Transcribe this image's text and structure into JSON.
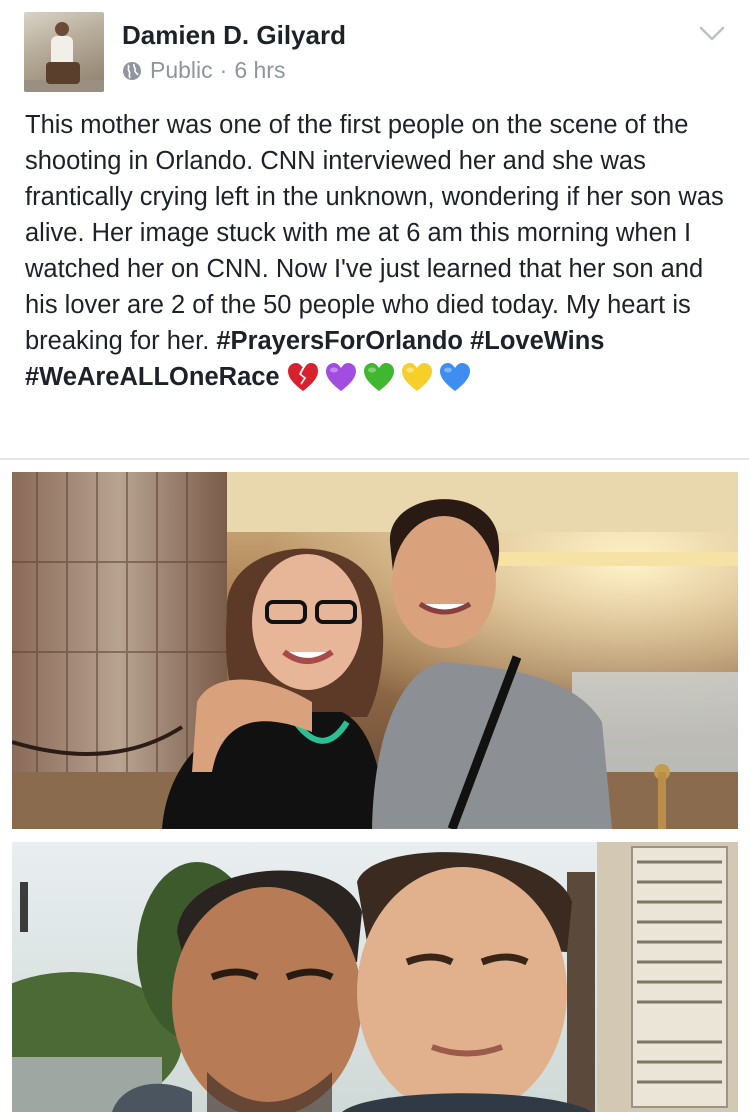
{
  "post": {
    "author": "Damien D. Gilyard",
    "privacy": "Public",
    "separator": "·",
    "timestamp": "6 hrs",
    "text_plain": "This mother was one of the first people on the scene of the shooting in Orlando. CNN interviewed her and she was frantically crying left in the unknown, wondering if her son was alive. Her image stuck with me at 6 am this morning when I watched her on CNN. Now I've just learned that her son and his lover are 2 of the 50 people who died today. My heart is breaking for her.",
    "hashtags": [
      "#PrayersForOrlando",
      "#LoveWins",
      "#WeAreALLOneRace"
    ],
    "emojis": [
      "broken-heart-icon",
      "purple-heart-icon",
      "green-heart-icon",
      "yellow-heart-icon",
      "blue-heart-icon"
    ]
  },
  "colors": {
    "text": "#1d2129",
    "meta": "#90949c",
    "divider": "#e5e6e9",
    "broken_heart": "#d8202e",
    "purple_heart": "#a24de0",
    "green_heart": "#3fb731",
    "yellow_heart": "#f6cf2b",
    "blue_heart": "#3d8ef0"
  }
}
